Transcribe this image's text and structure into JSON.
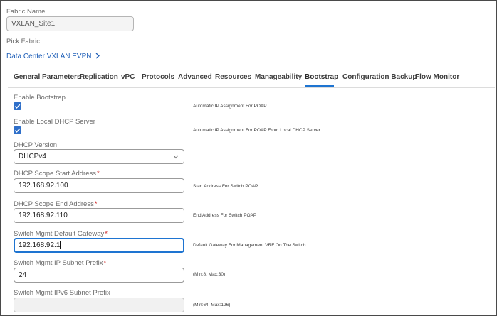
{
  "fabric_name": {
    "label": "Fabric Name",
    "value": "VXLAN_Site1"
  },
  "pick_fabric": {
    "label": "Pick Fabric",
    "link_text": "Data Center VXLAN EVPN"
  },
  "tabs": [
    {
      "label": "General Parameters"
    },
    {
      "label": "Replication"
    },
    {
      "label": "vPC"
    },
    {
      "label": "Protocols"
    },
    {
      "label": "Advanced"
    },
    {
      "label": "Resources"
    },
    {
      "label": "Manageability"
    },
    {
      "label": "Bootstrap"
    },
    {
      "label": "Configuration Backup"
    },
    {
      "label": "Flow Monitor"
    }
  ],
  "active_tab": "Bootstrap",
  "accent_color": "#1e74d1",
  "required_color": "#cc1f1f",
  "bootstrap": {
    "enable_bootstrap": {
      "label": "Enable Bootstrap",
      "checked": true,
      "help": "Automatic IP Assignment For POAP"
    },
    "enable_local_dhcp": {
      "label": "Enable Local DHCP Server",
      "checked": true,
      "help": "Automatic IP Assignment For POAP From Local DHCP Server"
    },
    "dhcp_version": {
      "label": "DHCP Version",
      "value": "DHCPv4"
    },
    "dhcp_scope_start": {
      "label": "DHCP Scope Start Address",
      "required_mark": "*",
      "value": "192.168.92.100",
      "help": "Start Address For Switch POAP"
    },
    "dhcp_scope_end": {
      "label": "DHCP Scope End Address",
      "required_mark": "*",
      "value": "192.168.92.110",
      "help": "End Address For Switch POAP"
    },
    "mgmt_gateway": {
      "label": "Switch Mgmt Default Gateway",
      "required_mark": "*",
      "value": "192.168.92.1",
      "help": "Default Gateway For Management VRF On The Switch"
    },
    "mgmt_ip_prefix": {
      "label": "Switch Mgmt IP Subnet Prefix",
      "required_mark": "*",
      "value": "24",
      "help": "(Min:8, Max:30)"
    },
    "mgmt_ipv6_prefix": {
      "label": "Switch Mgmt IPv6 Subnet Prefix",
      "value": "",
      "help": "(Min:64, Max:126)"
    }
  }
}
